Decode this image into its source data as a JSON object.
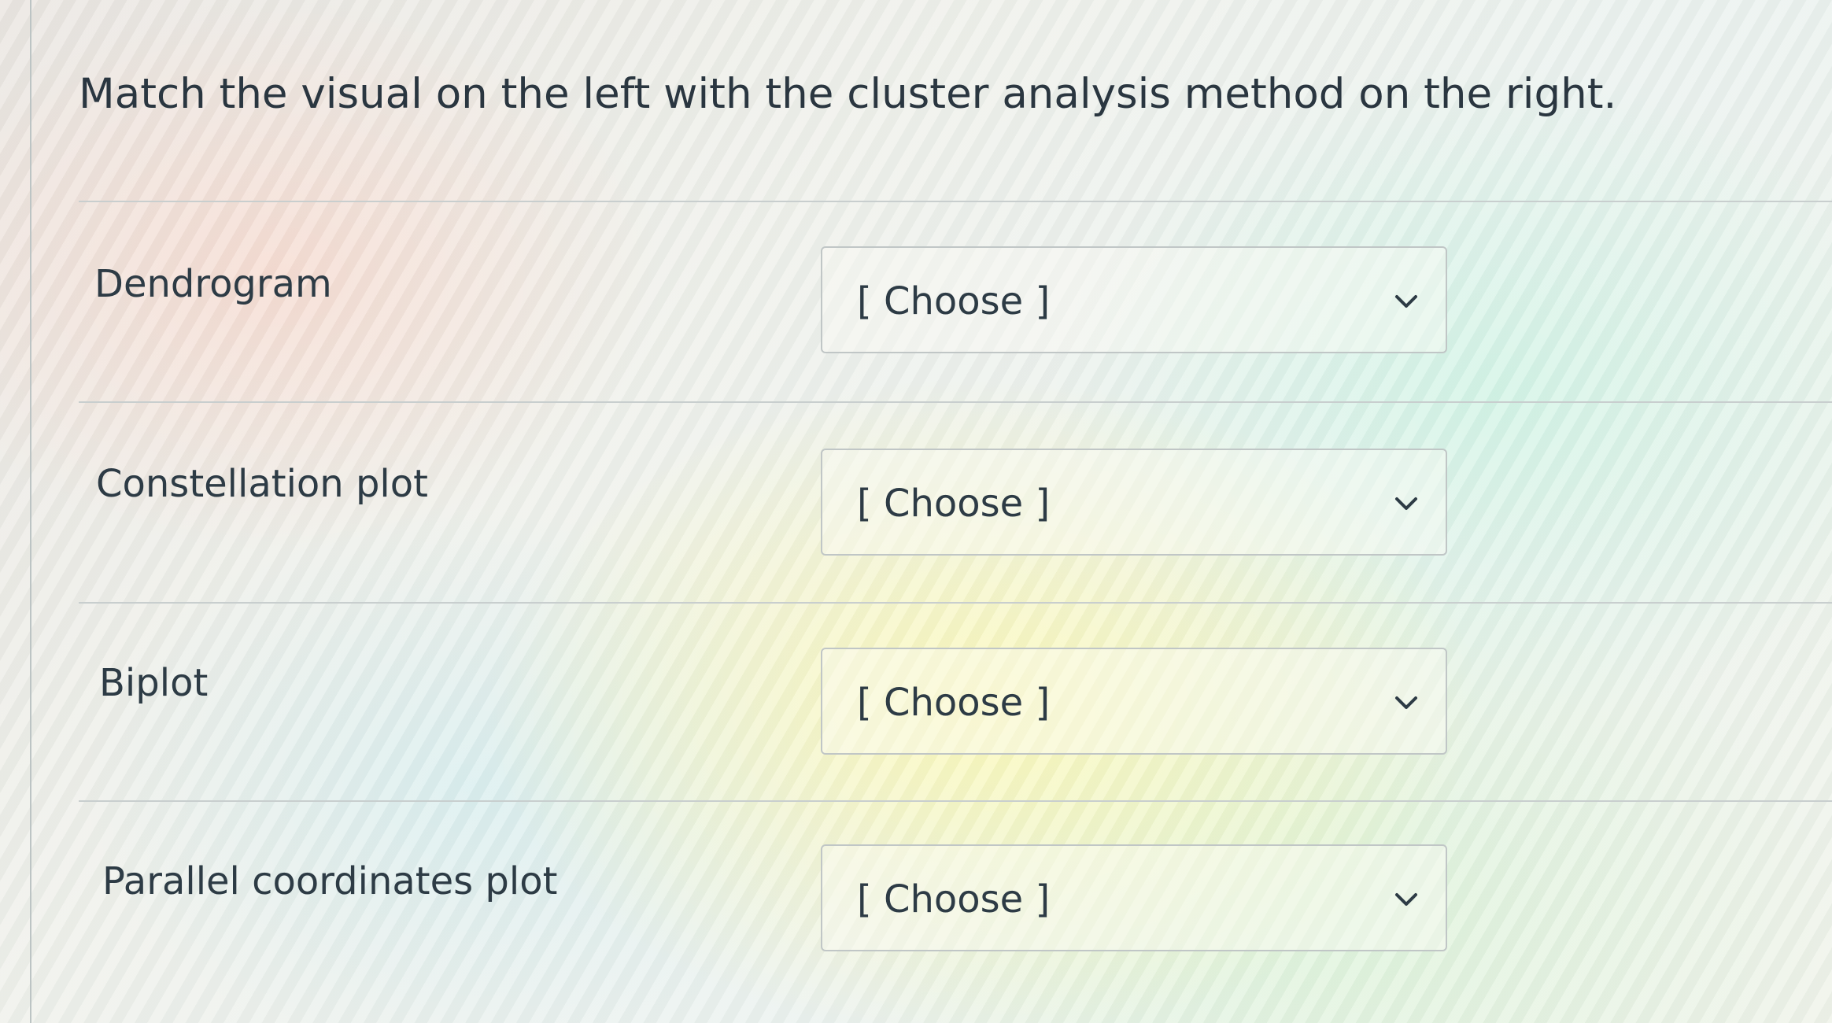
{
  "question": {
    "text": "Match the visual on the left with the cluster analysis method on the right."
  },
  "rows": [
    {
      "label": "Dendrogram",
      "select_value": "[ Choose ]"
    },
    {
      "label": "Constellation plot",
      "select_value": "[ Choose ]"
    },
    {
      "label": "Biplot",
      "select_value": "[ Choose ]"
    },
    {
      "label": "Parallel coordinates plot",
      "select_value": "[ Choose ]"
    }
  ],
  "icons": {
    "dropdown": "chevron-down-icon"
  },
  "colors": {
    "text": "#2d3b45",
    "border": "#c0c6c6",
    "separator": "#c8cece"
  }
}
